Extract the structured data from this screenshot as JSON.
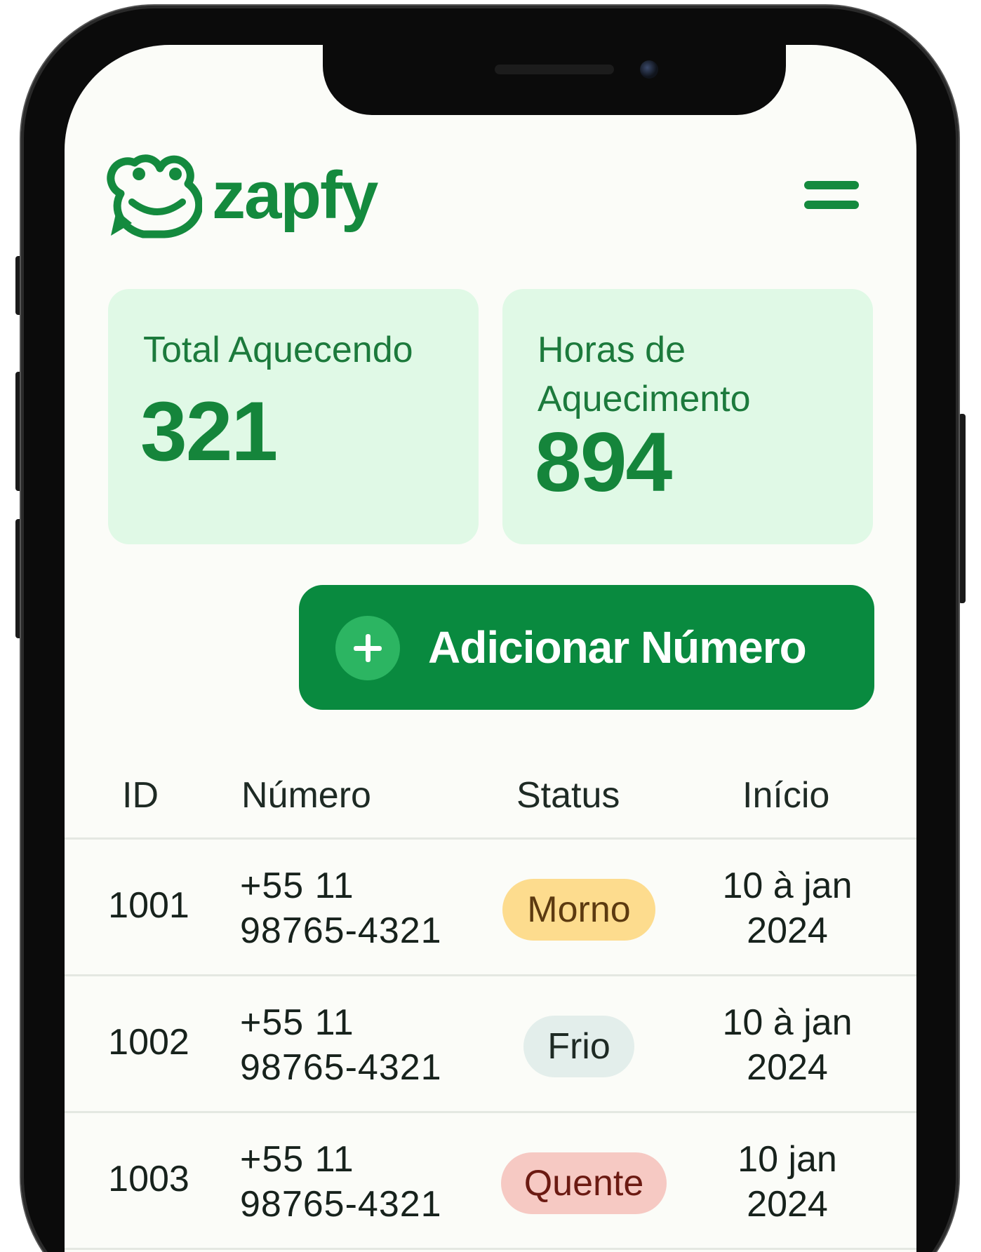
{
  "app": {
    "brand": "zapfy",
    "logo_icon": "frog-chat-icon",
    "menu_icon": "hamburger-menu-icon"
  },
  "stats": [
    {
      "label": "Total Aquecendo",
      "value": "321"
    },
    {
      "label": "Horas de Aquecimento",
      "value": "894"
    }
  ],
  "add_button": {
    "label": "Adicionar Número",
    "icon": "plus-icon"
  },
  "table": {
    "headers": [
      "ID",
      "Número",
      "Status",
      "Início"
    ],
    "rows": [
      {
        "id": "1001",
        "number": "+55 11 98765-4321",
        "status": "Morno",
        "date": "10 à jan 2024"
      },
      {
        "id": "1002",
        "number": "+55 11 98765-4321",
        "status": "Frio",
        "date": "10 à jan 2024"
      },
      {
        "id": "1003",
        "number": "+55 11 98765-4321",
        "status": "Quente",
        "date": "10 jan 2024"
      }
    ]
  },
  "colors": {
    "brand_green": "#148a3e",
    "button_green": "#098a3f",
    "card_bg": "#e0f9e6",
    "status_morno_bg": "#fddc8e",
    "status_morno_text": "#5c3a10",
    "status_frio_bg": "#e3eeeb",
    "status_frio_text": "#1e2a24",
    "status_quente_bg": "#f6c9c3",
    "status_quente_text": "#6b1a12"
  }
}
